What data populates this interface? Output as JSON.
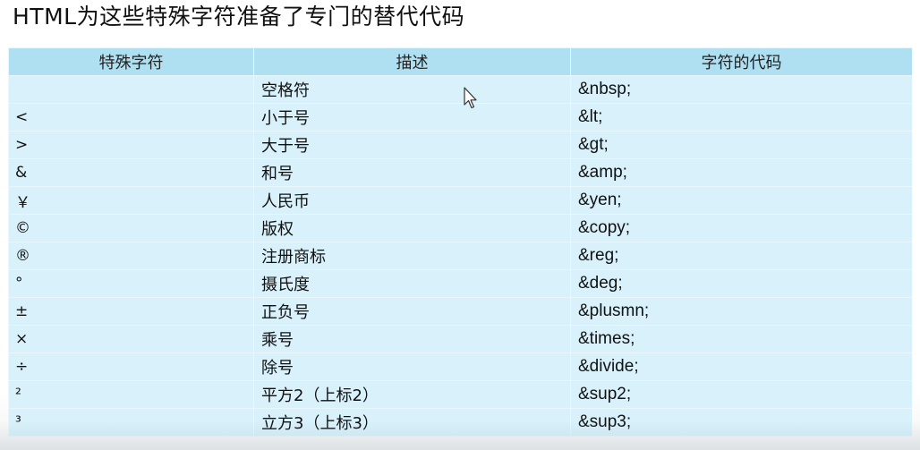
{
  "title": "HTML为这些特殊字符准备了专门的替代代码",
  "table": {
    "headers": [
      "特殊字符",
      "描述",
      "字符的代码"
    ],
    "rows": [
      {
        "symbol": "",
        "desc": "空格符",
        "code": "&nbsp;"
      },
      {
        "symbol": "<",
        "desc": "小于号",
        "code": "&lt;"
      },
      {
        "symbol": ">",
        "desc": "大于号",
        "code": "&gt;"
      },
      {
        "symbol": "&",
        "desc": "和号",
        "code": "&amp;"
      },
      {
        "symbol": "￥",
        "desc": "人民币",
        "code": "&yen;"
      },
      {
        "symbol": "©",
        "desc": "版权",
        "code": "&copy;"
      },
      {
        "symbol": "®",
        "desc": "注册商标",
        "code": "&reg;"
      },
      {
        "symbol": "°",
        "desc": "摄氏度",
        "code": "&deg;"
      },
      {
        "symbol": "±",
        "desc": "正负号",
        "code": "&plusmn;"
      },
      {
        "symbol": "×",
        "desc": "乘号",
        "code": "&times;"
      },
      {
        "symbol": "÷",
        "desc": "除号",
        "code": "&divide;"
      },
      {
        "symbol": "²",
        "desc": "平方2（上标2）",
        "code": "&sup2;"
      },
      {
        "symbol": "³",
        "desc": "立方3（上标3）",
        "code": "&sup3;"
      }
    ]
  },
  "cursor_icon": "mouse-pointer-icon",
  "colors": {
    "header_bg": "#aee0f2",
    "cell_bg": "#d8f1fb",
    "border": "#e9f6fa"
  }
}
